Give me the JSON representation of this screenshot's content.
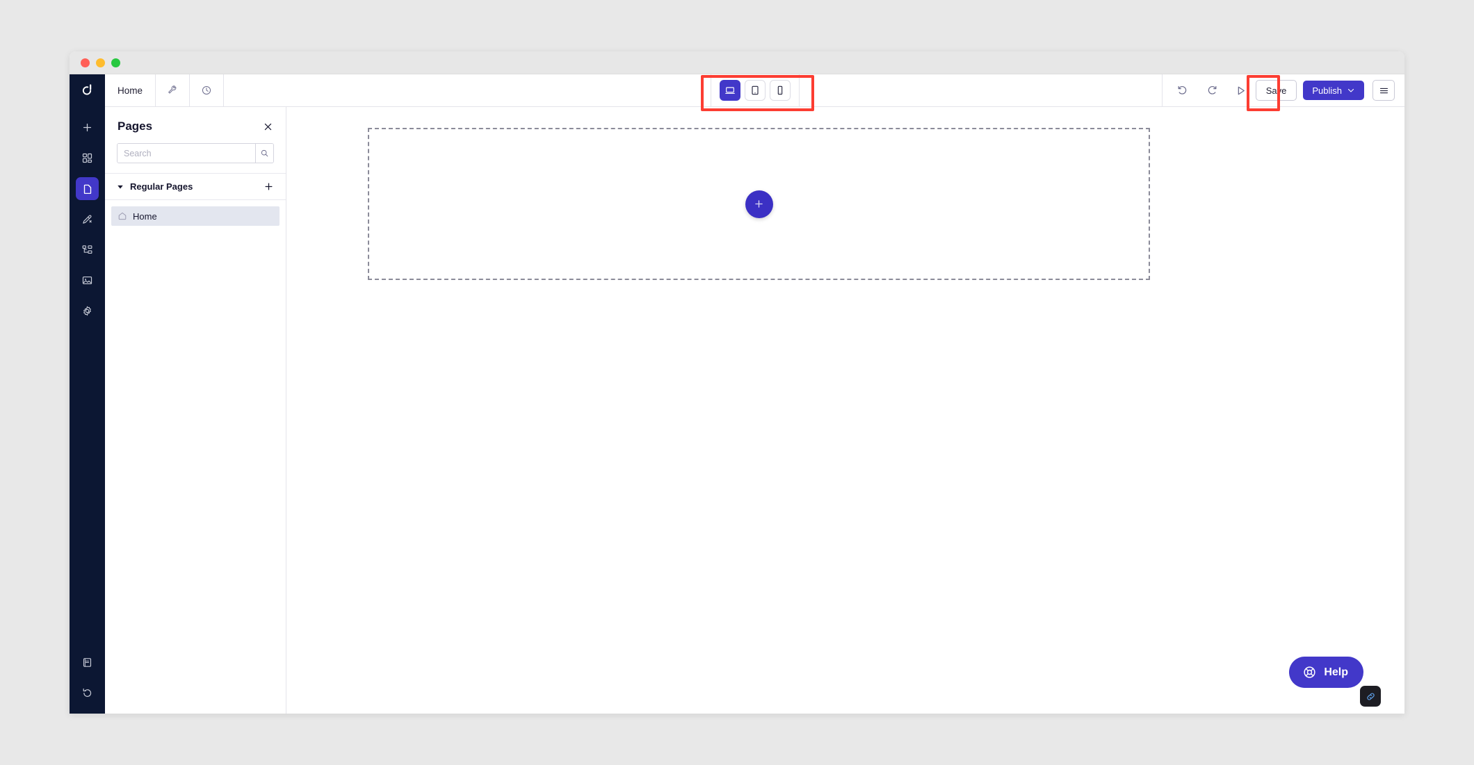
{
  "window": {
    "traffic_lights": [
      {
        "name": "close",
        "color": "#ff5f57"
      },
      {
        "name": "minimize",
        "color": "#febc2e"
      },
      {
        "name": "zoom",
        "color": "#28c840"
      }
    ]
  },
  "brand": {
    "logo_icon": "duda-logo-icon",
    "accent": "#4238c9",
    "publish_color": "#4238c9",
    "rail_bg": "#0c1733",
    "annotation_color": "#fc3d32"
  },
  "rail": {
    "items": [
      {
        "icon": "plus-icon",
        "name": "add-element",
        "active": false
      },
      {
        "icon": "grid-apps-icon",
        "name": "widgets",
        "active": false
      },
      {
        "icon": "page-icon",
        "name": "pages",
        "active": true
      },
      {
        "icon": "design-brush-icon",
        "name": "design",
        "active": false
      },
      {
        "icon": "sitemap-icon",
        "name": "site-structure",
        "active": false
      },
      {
        "icon": "image-icon",
        "name": "media",
        "active": false
      },
      {
        "icon": "gear-icon",
        "name": "settings",
        "active": false
      }
    ],
    "bottom_items": [
      {
        "icon": "book-icon",
        "name": "docs"
      },
      {
        "icon": "history-icon",
        "name": "history"
      }
    ]
  },
  "topbar": {
    "tabs": [
      {
        "label": "Home",
        "name": "tab-home",
        "type": "text"
      },
      {
        "label": "",
        "name": "tab-tools",
        "type": "icon",
        "icon": "wrench-icon"
      },
      {
        "label": "",
        "name": "tab-history",
        "type": "icon",
        "icon": "clock-icon"
      }
    ],
    "devices": [
      {
        "label": "Desktop",
        "icon": "desktop-icon",
        "active": true
      },
      {
        "label": "Tablet",
        "icon": "tablet-icon",
        "active": false
      },
      {
        "label": "Mobile",
        "icon": "mobile-icon",
        "active": false
      }
    ],
    "undo_label": "Undo",
    "redo_label": "Redo",
    "preview_label": "Preview",
    "save_label": "Save",
    "publish_label": "Publish",
    "menu_label": "Menu"
  },
  "panel": {
    "title": "Pages",
    "close_label": "Close",
    "search": {
      "value": "",
      "placeholder": "Search"
    },
    "section": {
      "title": "Regular Pages",
      "add_label": "Add page",
      "expanded": true
    },
    "pages": [
      {
        "label": "Home",
        "icon": "home-icon",
        "selected": true
      }
    ]
  },
  "canvas": {
    "add_section_label": "+",
    "placeholder_hint": ""
  },
  "help": {
    "label": "Help",
    "icon": "lifebuoy-icon"
  },
  "link_badge": {
    "icon": "chain-link-icon"
  }
}
